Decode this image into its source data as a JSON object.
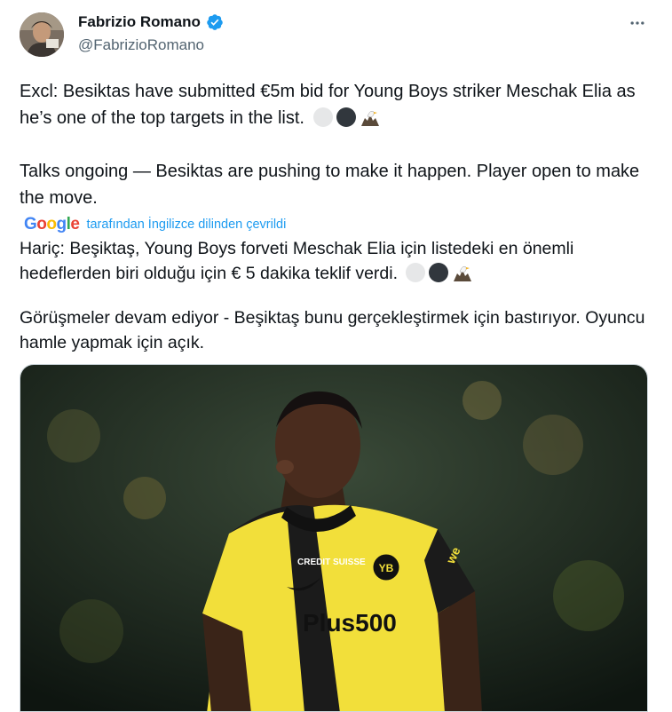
{
  "author": {
    "name": "Fabrizio Romano",
    "handle": "@FabrizioRomano",
    "avatar_icon": "avatar-photo",
    "verified_icon": "verified-badge-icon",
    "verified_color": "#1d9bf0"
  },
  "tweet": {
    "line1_text": "Excl: Besiktas have submitted €5m bid for Young Boys striker Meschak Elia as he’s one of the top targets in the list.",
    "line2_text": "Talks ongoing — Besiktas are pushing to make it happen. Player open to make the move."
  },
  "translation": {
    "google_logo": "Google",
    "attribution": "tarafından İngilizce dilinden çevrildi",
    "line1_text": "Hariç: Beşiktaş, Young Boys forveti Meschak Elia için listedeki en önemli hedeflerden biri olduğu için € 5 dakika teklif verdi.",
    "line2_text": "Görüşmeler devam ediyor - Beşiktaş bunu gerçekleştirmek için bastırıyor. Oyuncu hamle yapmak için açık."
  },
  "media": {
    "jersey_sponsor_chest": "CREDIT SUISSE",
    "jersey_sponsor_main": "Plus500",
    "jersey_sleeve": "we",
    "badge_text": "YB"
  },
  "icons": {
    "more": "more-options-icon",
    "emoji": [
      "white-circle",
      "black-circle",
      "eagle"
    ]
  },
  "colors": {
    "text_primary": "#0f1419",
    "text_secondary": "#536471",
    "link": "#1d9bf0",
    "kit_yellow": "#f2df3a",
    "kit_black": "#1b1b1b"
  }
}
